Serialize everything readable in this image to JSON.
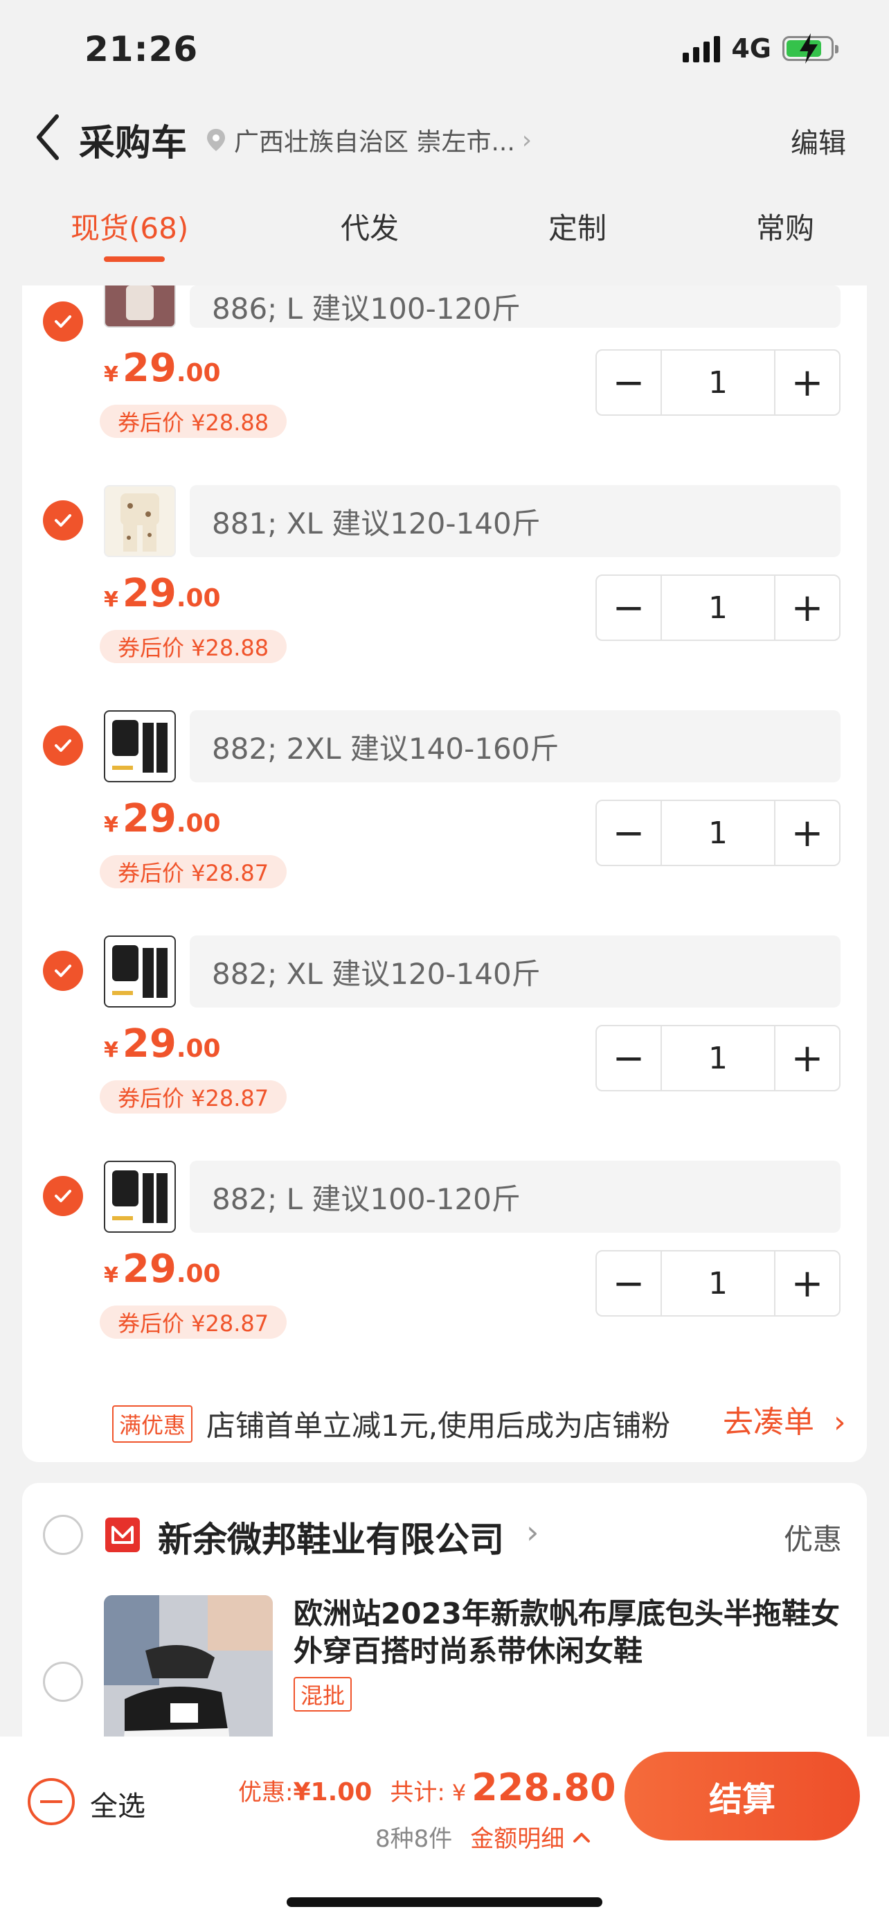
{
  "status_bar": {
    "time": "21:26",
    "network": "4G"
  },
  "nav": {
    "title": "采购车",
    "location": "广西壮族自治区 崇左市...",
    "edit_label": "编辑"
  },
  "tabs": [
    {
      "label": "现货(68)",
      "active": true
    },
    {
      "label": "代发",
      "active": false
    },
    {
      "label": "定制",
      "active": false
    },
    {
      "label": "常购",
      "active": false
    }
  ],
  "items": [
    {
      "spec": "886; L 建议100-120斤",
      "price_symbol": "¥",
      "price_int": "29",
      "price_dec": ".00",
      "coupon": "券后价 ¥28.88",
      "qty": "1"
    },
    {
      "spec": "881; XL 建议120-140斤",
      "price_symbol": "¥",
      "price_int": "29",
      "price_dec": ".00",
      "coupon": "券后价 ¥28.88",
      "qty": "1"
    },
    {
      "spec": "882; 2XL 建议140-160斤",
      "price_symbol": "¥",
      "price_int": "29",
      "price_dec": ".00",
      "coupon": "券后价 ¥28.87",
      "qty": "1"
    },
    {
      "spec": "882; XL 建议120-140斤",
      "price_symbol": "¥",
      "price_int": "29",
      "price_dec": ".00",
      "coupon": "券后价 ¥28.87",
      "qty": "1"
    },
    {
      "spec": "882; L 建议100-120斤",
      "price_symbol": "¥",
      "price_int": "29",
      "price_dec": ".00",
      "coupon": "券后价 ¥28.87",
      "qty": "1"
    }
  ],
  "promo": {
    "tag": "满优惠",
    "text": "店铺首单立减1元,使用后成为店铺粉",
    "link": "去凑单"
  },
  "shop2": {
    "name": "新余微邦鞋业有限公司",
    "offer": "优惠",
    "product_title": "欧洲站2023年新款帆布厚底包头半拖鞋女外穿百搭时尚系带休闲女鞋",
    "product_tag": "混批"
  },
  "bottom": {
    "select_all": "全选",
    "discount_label": "优惠:",
    "discount_value": "¥1.00",
    "total_label": "共计:",
    "total_symbol": "¥",
    "total_value": "228.80",
    "count": "8种8件",
    "detail_link": "金额明细",
    "checkout": "结算"
  },
  "colors": {
    "accent": "#f0542b",
    "coupon_bg": "#fde9e2",
    "page_bg": "#f2f2f2"
  }
}
